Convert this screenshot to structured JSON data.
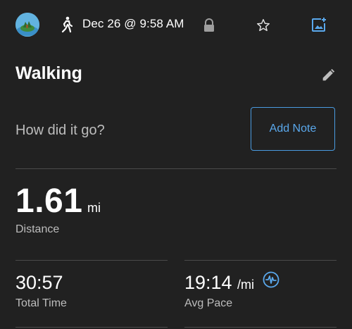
{
  "toolbar": {
    "activity_icon": "walking-icon",
    "date_time": "Dec 26 @ 9:58 AM",
    "icons": [
      "lock-icon",
      "star-icon",
      "add-photo-icon"
    ]
  },
  "activity": {
    "title": "Walking",
    "edit_icon": "pencil-icon"
  },
  "note": {
    "prompt": "How did it go?",
    "button_label": "Add Note"
  },
  "stats": {
    "distance": {
      "value": "1.61",
      "unit": "mi",
      "label": "Distance"
    },
    "total_time": {
      "value": "30:57",
      "label": "Total Time"
    },
    "avg_pace": {
      "value": "19:14",
      "unit": "/mi",
      "label": "Avg Pace",
      "icon": "pulse-icon"
    }
  },
  "colors": {
    "background": "#212121",
    "accent": "#4a9be0",
    "secondary_text": "#bdbdbd"
  }
}
